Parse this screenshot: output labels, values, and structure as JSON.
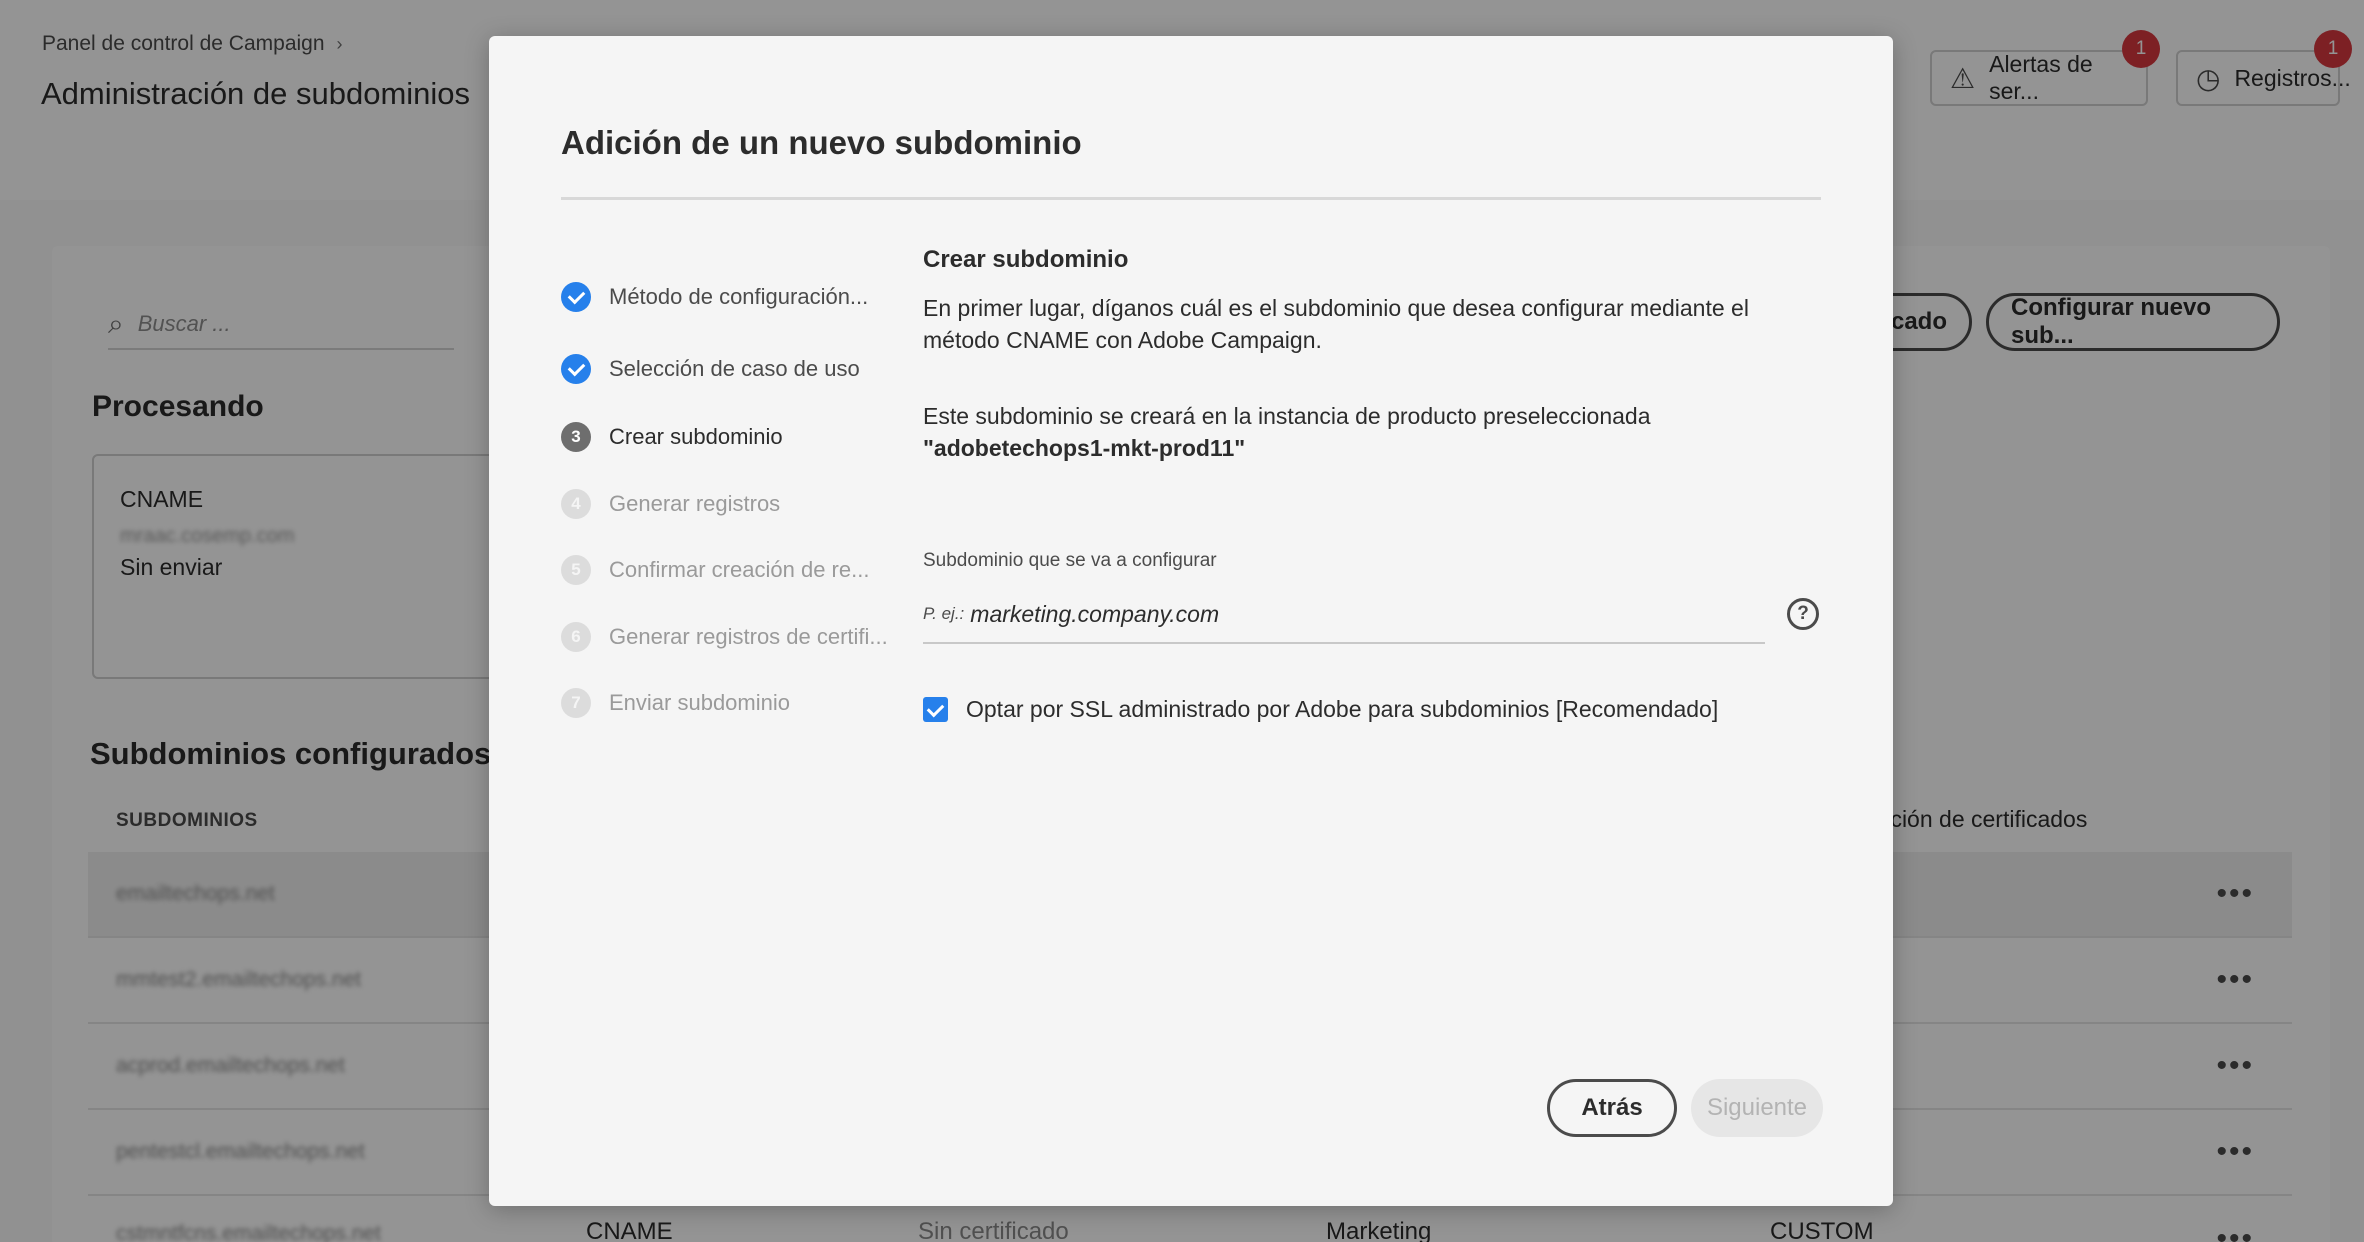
{
  "header": {
    "breadcrumb": "Panel de control de Campaign",
    "breadcrumb_sep": "›",
    "title": "Administración de subdominios",
    "alerts_label": "Alertas de ser...",
    "alerts_count": "1",
    "logs_label": "Registros...",
    "logs_count": "1"
  },
  "toolbar": {
    "search_placeholder": "Buscar ...",
    "certificate_button": "cado",
    "configure_button": "Configurar nuevo sub..."
  },
  "processing": {
    "title": "Procesando",
    "card_type": "CNAME",
    "card_domain": "mraac.cosemp.com",
    "card_status": "Sin enviar"
  },
  "configured": {
    "title": "Subdominios configurados",
    "col_subdomains": "SUBDOMINIOS",
    "col_cert": "ración de certificados",
    "rows": [
      "emailtechops.net",
      "mmtest2.emailtechops.net",
      "acprod.emailtechops.net",
      "pentestcl.emailtechops.net",
      "cstmntfcns.emailtechops.net"
    ],
    "more_label": "•••",
    "last_row": {
      "type": "CNAME",
      "cert": "Sin certificado",
      "use_case": "Marketing",
      "kind": "CUSTOM"
    }
  },
  "modal": {
    "title": "Adición de un nuevo subdominio",
    "steps": [
      {
        "num": "1",
        "label": "Método de configuración..."
      },
      {
        "num": "2",
        "label": "Selección de caso de uso"
      },
      {
        "num": "3",
        "label": "Crear subdominio"
      },
      {
        "num": "4",
        "label": "Generar registros"
      },
      {
        "num": "5",
        "label": "Confirmar creación de re..."
      },
      {
        "num": "6",
        "label": "Generar registros de certifi..."
      },
      {
        "num": "7",
        "label": "Enviar subdominio"
      }
    ],
    "content_title": "Crear subdominio",
    "description": "En primer lugar, díganos cuál es el subdominio que desea configurar mediante el método CNAME con Adobe Campaign.",
    "info_prefix": "Este subdominio se creará en la instancia de producto preseleccionada ",
    "info_instance": "\"adobetechops1-mkt-prod11\"",
    "field_label": "Subdominio que se va a configurar",
    "field_prefix": "P. ej.:",
    "field_placeholder": "marketing.company.com",
    "help_glyph": "?",
    "ssl_label": "Optar por SSL administrado por Adobe para subdominios [Recomendado]",
    "ssl_checked": true,
    "back_button": "Atrás",
    "next_button": "Siguiente"
  },
  "colors": {
    "accent": "#2680eb",
    "badge": "#d7373f",
    "overlay": "rgba(0,0,0,0.42)"
  }
}
